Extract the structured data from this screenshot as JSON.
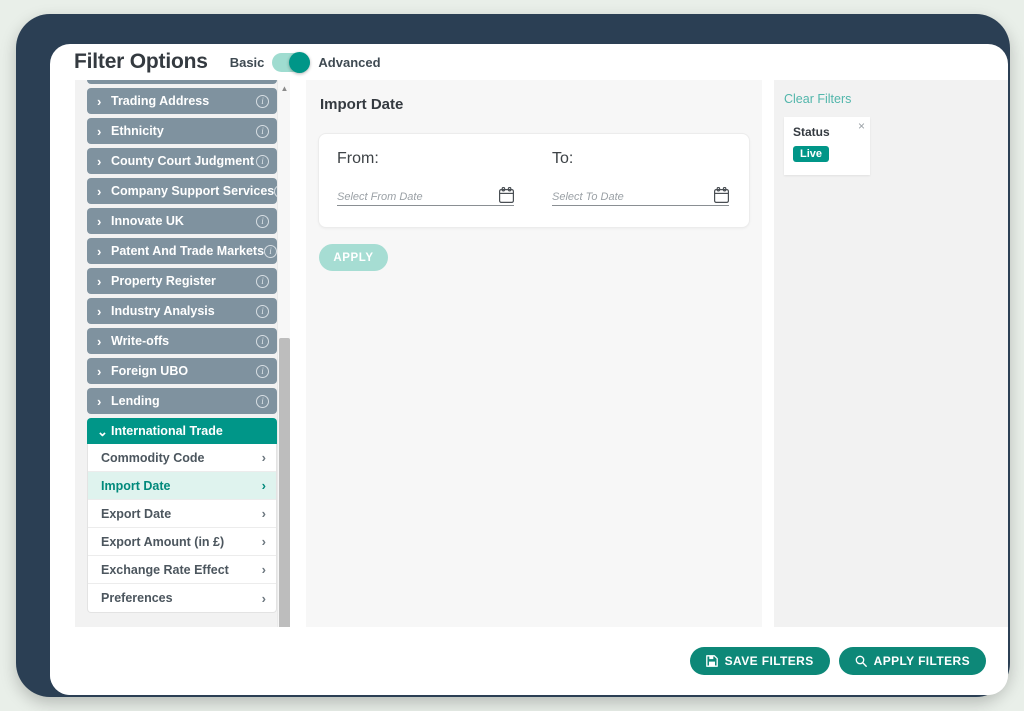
{
  "header": {
    "title": "Filter Options",
    "toggle": {
      "left_label": "Basic",
      "right_label": "Advanced",
      "state": "Advanced"
    }
  },
  "sidebar": {
    "categories": [
      {
        "label": "Trading Address",
        "icon": "info-icon",
        "expanded": false
      },
      {
        "label": "Ethnicity",
        "icon": "info-icon",
        "expanded": false
      },
      {
        "label": "County Court Judgment",
        "icon": "info-icon",
        "expanded": false
      },
      {
        "label": "Company Support Services",
        "icon": "info-icon",
        "expanded": false
      },
      {
        "label": "Innovate UK",
        "icon": "info-icon",
        "expanded": false
      },
      {
        "label": "Patent And Trade Markets",
        "icon": "info-icon",
        "expanded": false
      },
      {
        "label": "Property Register",
        "icon": "info-icon",
        "expanded": false
      },
      {
        "label": "Industry Analysis",
        "icon": "info-icon",
        "expanded": false
      },
      {
        "label": "Write-offs",
        "icon": "info-icon",
        "expanded": false
      },
      {
        "label": "Foreign UBO",
        "icon": "info-icon",
        "expanded": false
      },
      {
        "label": "Lending",
        "icon": "info-icon",
        "expanded": false
      }
    ],
    "active_category": {
      "label": "International Trade",
      "expanded": true
    },
    "sub_items": [
      {
        "label": "Commodity Code",
        "selected": false
      },
      {
        "label": "Import Date",
        "selected": true
      },
      {
        "label": "Export Date",
        "selected": false
      },
      {
        "label": "Export Amount (in £)",
        "selected": false
      },
      {
        "label": "Exchange Rate Effect",
        "selected": false
      },
      {
        "label": "Preferences",
        "selected": false
      }
    ]
  },
  "main": {
    "panel_title": "Import Date",
    "from": {
      "label": "From:",
      "placeholder": "Select From Date",
      "value": ""
    },
    "to": {
      "label": "To:",
      "placeholder": "Select To Date",
      "value": ""
    },
    "apply_label": "APPLY"
  },
  "applied_filters": {
    "clear_label": "Clear Filters",
    "chips": [
      {
        "title": "Status",
        "value": "Live",
        "close": "×"
      }
    ]
  },
  "footer": {
    "save_label": "SAVE FILTERS",
    "apply_label": "APPLY FILTERS"
  },
  "colors": {
    "accent_teal": "#009688",
    "accent_teal_dark": "#0d8878",
    "accent_teal_light": "#a6ddd3",
    "category_gray": "#7f929f",
    "selected_row_bg": "#dff3ee",
    "bezel": "#2b3f54",
    "page_bg": "#e9efe9",
    "link_teal": "#52b6ab"
  }
}
